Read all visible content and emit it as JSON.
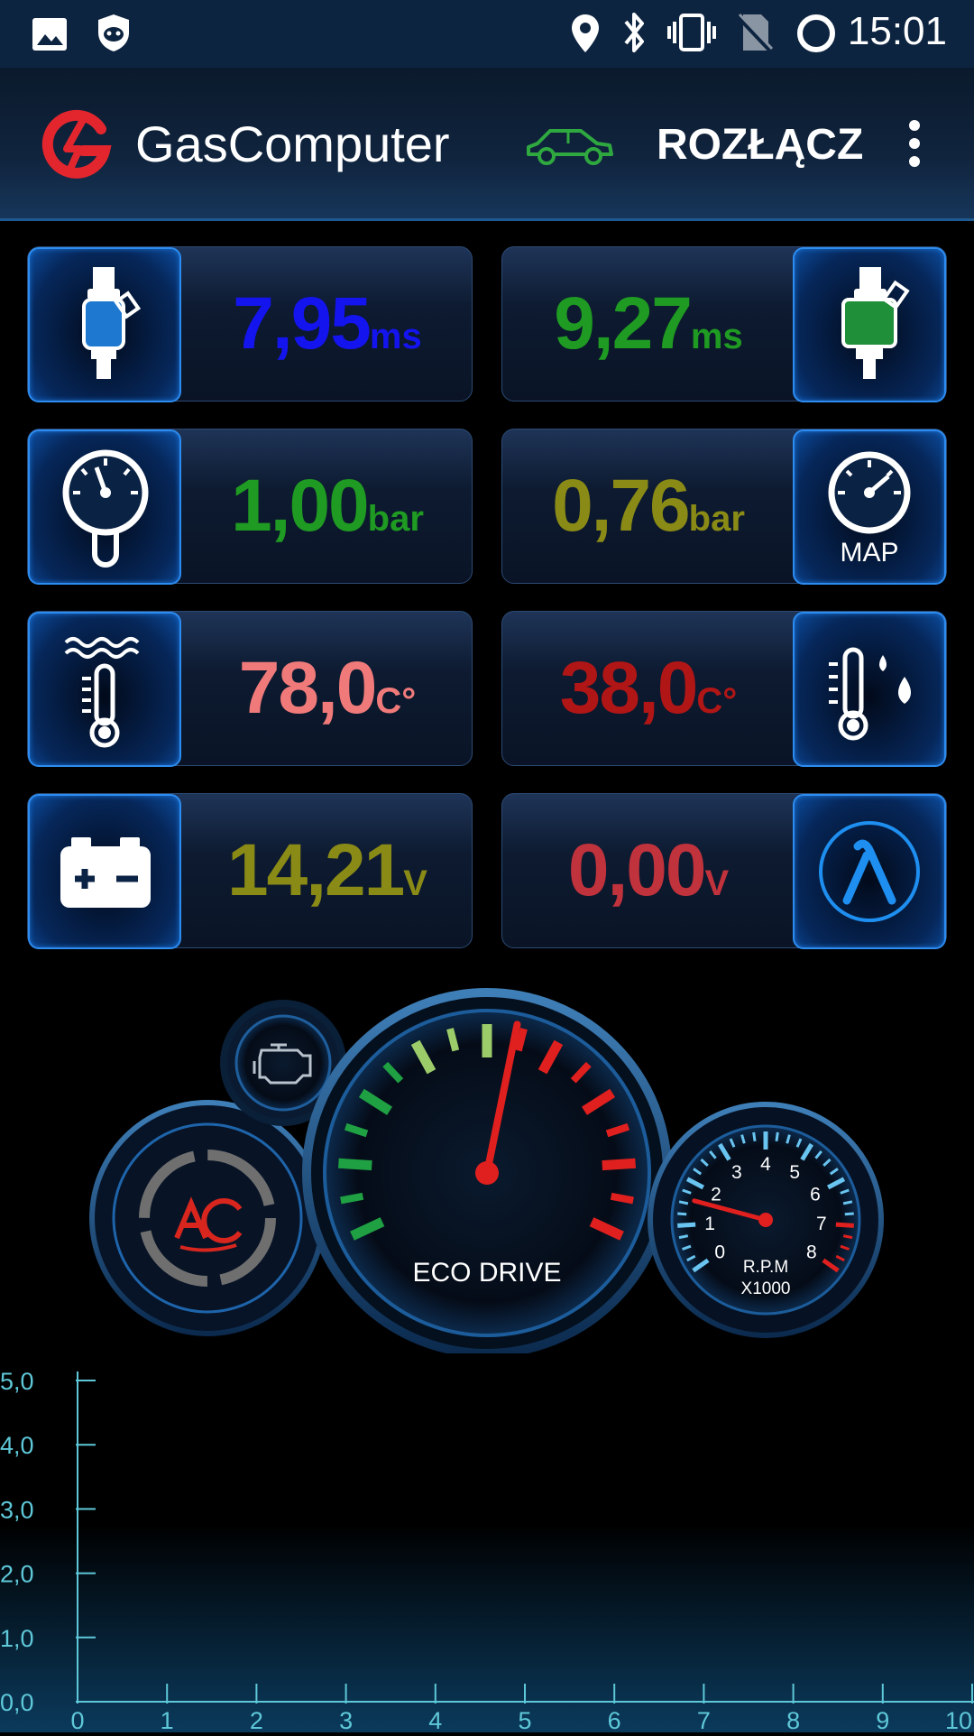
{
  "status_bar": {
    "time": "15:01",
    "icons": [
      "image-icon",
      "shield-cat-icon",
      "location-icon",
      "bluetooth-icon",
      "vibrate-icon",
      "no-sim-icon",
      "loading-circle-icon"
    ]
  },
  "app_bar": {
    "title": "GasComputer",
    "logo": "gascomputer-logo-icon",
    "car_icon_color": "#2fa840",
    "disconnect_label": "ROZŁĄCZ",
    "menu_icon": "more-vert-icon"
  },
  "tiles": {
    "petrol_injection": {
      "value": "7,95",
      "unit": "ms",
      "color": "#1414ee",
      "icon": "petrol-injector-icon"
    },
    "gas_injection": {
      "value": "9,27",
      "unit": "ms",
      "color": "#1f9a22",
      "icon": "gas-injector-icon"
    },
    "gas_pressure": {
      "value": "1,00",
      "unit": "bar",
      "color": "#1f9a22",
      "icon": "pressure-gauge-icon"
    },
    "map_pressure": {
      "value": "0,76",
      "unit": "bar",
      "color": "#8a8a16",
      "icon": "map-gauge-icon",
      "label": "MAP"
    },
    "reducer_temp": {
      "value": "78,0",
      "unit": "C°",
      "color": "#f07a7a",
      "icon": "coolant-temp-icon"
    },
    "gas_temp": {
      "value": "38,0",
      "unit": "C°",
      "color": "#b01616",
      "icon": "gas-temp-icon"
    },
    "battery": {
      "value": "14,21",
      "unit": "V",
      "color": "#8a8a16",
      "icon": "battery-icon"
    },
    "lambda": {
      "value": "0,00",
      "unit": "V",
      "color": "#c0323c",
      "icon": "lambda-icon"
    }
  },
  "gauges": {
    "eco_label": "ECO DRIVE",
    "rpm_label": "R.P.M",
    "rpm_multiplier": "X1000",
    "rpm_ticks": [
      "0",
      "1",
      "2",
      "3",
      "4",
      "5",
      "6",
      "7",
      "8"
    ],
    "rpm_value": 1.6,
    "eco_level": 0.55,
    "ac_icon": "ac-logo-icon",
    "engine_icon": "check-engine-icon"
  },
  "chart_data": {
    "type": "line",
    "x_ticks": [
      "0",
      "1",
      "2",
      "3",
      "4",
      "5",
      "6",
      "7",
      "8",
      "9",
      "10"
    ],
    "y_ticks": [
      "0,0",
      "1,0",
      "2,0",
      "3,0",
      "4,0",
      "5,0"
    ],
    "xlim": [
      0,
      10
    ],
    "ylim": [
      0,
      5
    ],
    "series": [],
    "grid": false,
    "axis_color": "#5ec8d8"
  }
}
